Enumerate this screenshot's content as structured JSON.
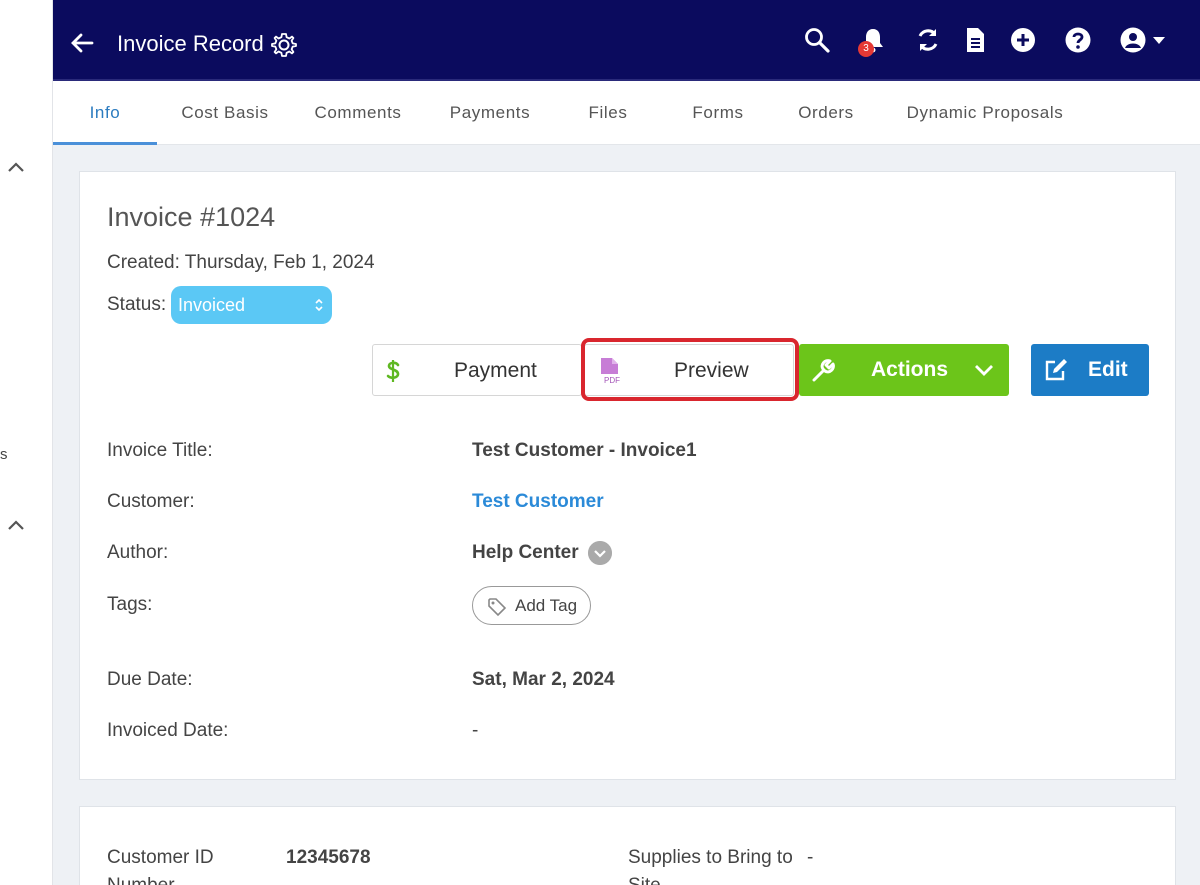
{
  "header": {
    "title": "Invoice Record",
    "notification_count": "3"
  },
  "tabs": [
    {
      "label": "Info"
    },
    {
      "label": "Cost Basis"
    },
    {
      "label": "Comments"
    },
    {
      "label": "Payments"
    },
    {
      "label": "Files"
    },
    {
      "label": "Forms"
    },
    {
      "label": "Orders"
    },
    {
      "label": "Dynamic Proposals"
    }
  ],
  "sidebar": {
    "fragment": "s"
  },
  "invoice": {
    "title": "Invoice #1024",
    "created": "Created: Thursday, Feb 1, 2024",
    "status_label": "Status:",
    "status_value": "Invoiced"
  },
  "buttons": {
    "payment": "Payment",
    "preview": "Preview",
    "preview_icon_text": "PDF",
    "actions": "Actions",
    "edit": "Edit"
  },
  "colors": {
    "header_bg": "#0b0b5e",
    "status": "#5bc8f5",
    "actions": "#6cc51a",
    "edit": "#1c7cc6",
    "highlight": "#d9262e",
    "link": "#2b8ad8"
  },
  "fields": {
    "invoice_title_label": "Invoice Title:",
    "invoice_title_value": "Test Customer - Invoice1",
    "customer_label": "Customer:",
    "customer_value": "Test Customer",
    "author_label": "Author:",
    "author_value": "Help Center",
    "tags_label": "Tags:",
    "add_tag": "Add Tag",
    "due_date_label": "Due Date:",
    "due_date_value": "Sat, Mar 2, 2024",
    "invoiced_date_label": "Invoiced Date:",
    "invoiced_date_value": "-"
  },
  "details": {
    "customer_id_label": "Customer ID",
    "customer_id_label_cont": "Number",
    "customer_id_value": "12345678",
    "supplies_label": "Supplies to Bring to",
    "supplies_label_cont": "Site",
    "supplies_value": "-"
  }
}
